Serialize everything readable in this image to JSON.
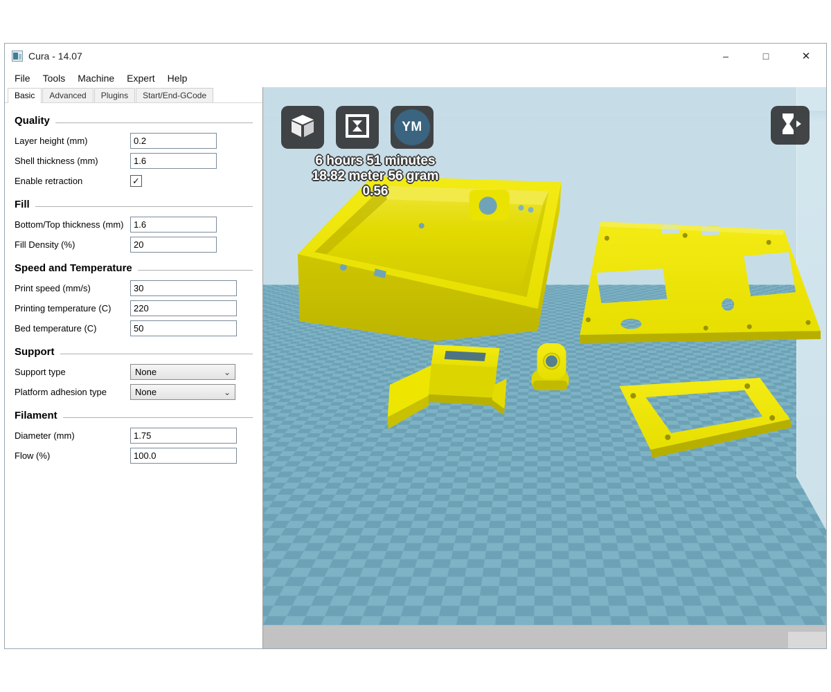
{
  "window": {
    "title": "Cura - 14.07",
    "minimize": "–",
    "maximize": "□",
    "close": "✕"
  },
  "menu": {
    "file": "File",
    "tools": "Tools",
    "machine": "Machine",
    "expert": "Expert",
    "help": "Help"
  },
  "tabs": {
    "basic": "Basic",
    "advanced": "Advanced",
    "plugins": "Plugins",
    "gcode": "Start/End-GCode"
  },
  "panel": {
    "sections": {
      "quality": {
        "title": "Quality",
        "rows": {
          "layer_height": {
            "label": "Layer height (mm)",
            "value": "0.2"
          },
          "shell_thickness": {
            "label": "Shell thickness (mm)",
            "value": "1.6"
          },
          "enable_retraction": {
            "label": "Enable retraction",
            "checked": "✓"
          }
        }
      },
      "fill": {
        "title": "Fill",
        "rows": {
          "bottom_top_thickness": {
            "label": "Bottom/Top thickness (mm)",
            "value": "1.6"
          },
          "fill_density": {
            "label": "Fill Density (%)",
            "value": "20"
          }
        }
      },
      "speed_temp": {
        "title": "Speed and Temperature",
        "rows": {
          "print_speed": {
            "label": "Print speed (mm/s)",
            "value": "30"
          },
          "print_temp": {
            "label": "Printing temperature (C)",
            "value": "220"
          },
          "bed_temp": {
            "label": "Bed temperature (C)",
            "value": "50"
          }
        }
      },
      "support": {
        "title": "Support",
        "rows": {
          "support_type": {
            "label": "Support type",
            "value": "None"
          },
          "adhesion_type": {
            "label": "Platform adhesion type",
            "value": "None"
          }
        }
      },
      "filament": {
        "title": "Filament",
        "rows": {
          "diameter": {
            "label": "Diameter (mm)",
            "value": "1.75"
          },
          "flow": {
            "label": "Flow (%)",
            "value": "100.0"
          }
        }
      }
    }
  },
  "viewport": {
    "stats": {
      "line1": "6 hours 51 minutes",
      "line2": "18.82 meter 56 gram",
      "line3": "0.56"
    },
    "toolbar": {
      "youmagine_label": "YM"
    },
    "colors": {
      "model_yellow": "#efe600",
      "platform_checker_dark": "#6da2b6",
      "platform_checker_light": "#7eb3c6",
      "viewport_background": "#c6dde8",
      "toolbar_button_bg": "#2d2d2d",
      "youmagine_blue": "#3a647f",
      "front_band_gray": "#c2c2c2"
    },
    "icons": {
      "load_model": "white 3d cube",
      "toolpath_view": "square outline with bowtie",
      "view_mode": "hourglass with play triangle"
    }
  },
  "glyphs": {
    "check": "✓",
    "chevron_down": "⌄"
  }
}
